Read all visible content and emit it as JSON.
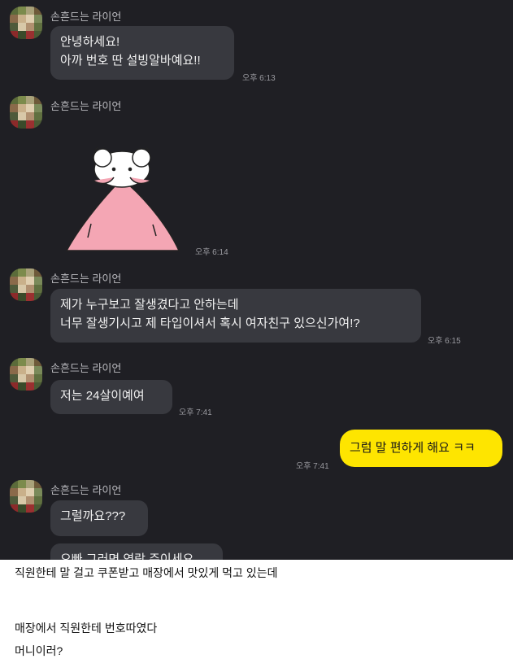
{
  "chat": {
    "sender_name": "손흔드는 라이언",
    "messages": [
      {
        "lines": [
          "안녕하세요!",
          "아까 번호 딴 설빙알바예요!!"
        ],
        "time": "오후 6:13"
      },
      {
        "sticker": "bear-in-pink-blanket",
        "time": "오후 6:14"
      },
      {
        "lines": [
          "제가 누구보고 잘생겼다고 안하는데",
          "너무 잘생기시고 제 타입이셔서 혹시 여자친구 있으신가여!?"
        ],
        "time": "오후 6:15"
      },
      {
        "lines": [
          "저는 24살이예여"
        ],
        "time": "오후 7:41"
      },
      {
        "mine": true,
        "lines": [
          "그럼 말 편하게 해요 ㅋㅋ"
        ],
        "time": "오후 7:41"
      },
      {
        "lines": [
          "그럴까요???"
        ]
      },
      {
        "lines": [
          "오빠 그러면 연락 주이세요"
        ]
      }
    ],
    "colors": {
      "background": "#1f1f24",
      "bubble": "#38393f",
      "my_bubble": "#fee500"
    }
  },
  "footer": {
    "line1": "직원한테 말 걸고 쿠폰받고 매장에서 맛있게 먹고 있는데",
    "line2": "매장에서 직원한테 번호따였다",
    "line3": "머니이러?"
  }
}
